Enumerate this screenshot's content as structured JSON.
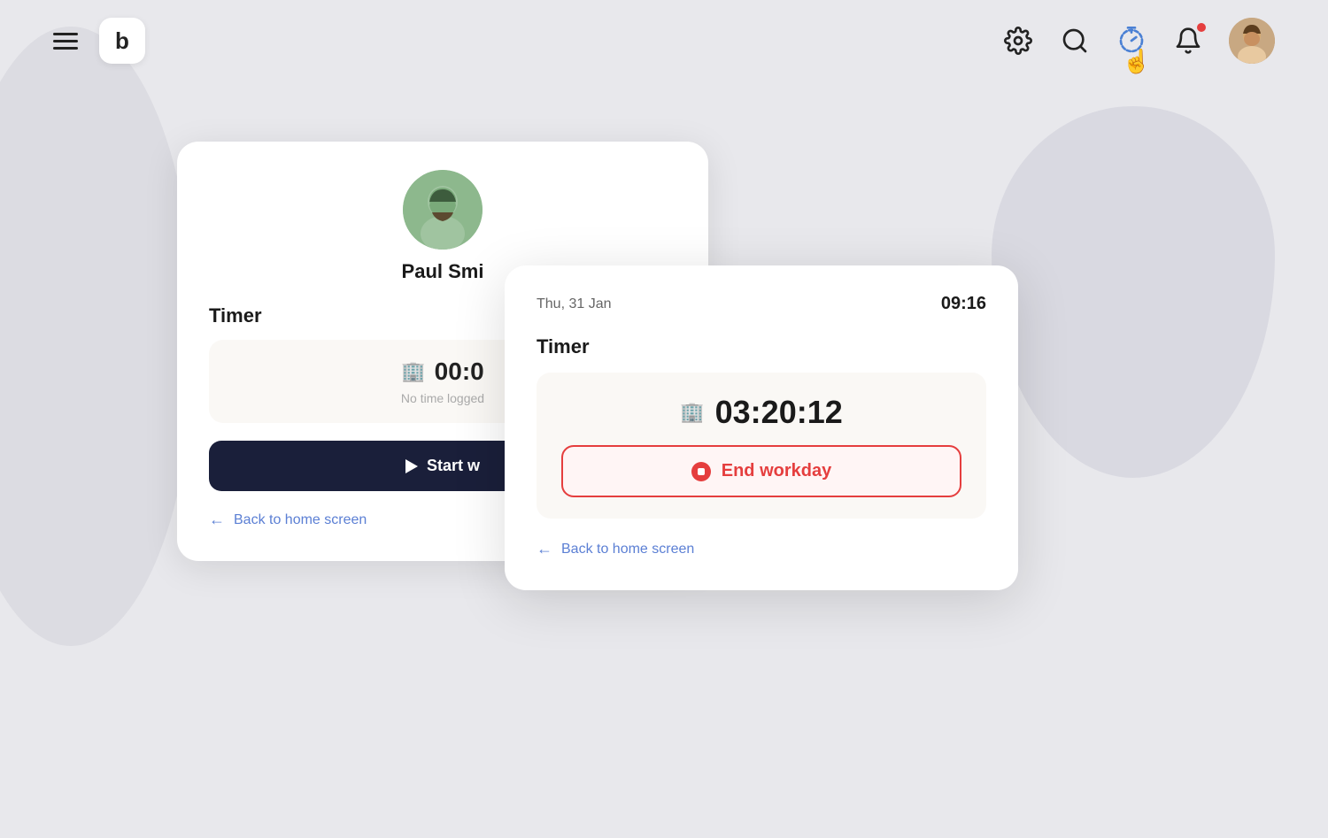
{
  "navbar": {
    "logo": "b",
    "icons": {
      "settings": "settings-icon",
      "search": "search-icon",
      "timer": "timer-icon",
      "bell": "bell-icon"
    }
  },
  "card_behind": {
    "user_name": "Paul Smi",
    "timer_label": "Timer",
    "time_display": "00:0",
    "no_time_text": "No time logged",
    "start_button": "Start w",
    "back_link": "Back to home screen"
  },
  "card_front": {
    "date": "Thu, 31 Jan",
    "time": "09:16",
    "timer_label": "Timer",
    "time_display": "03:20:12",
    "end_button": "End workday",
    "back_link": "Back to home screen"
  }
}
